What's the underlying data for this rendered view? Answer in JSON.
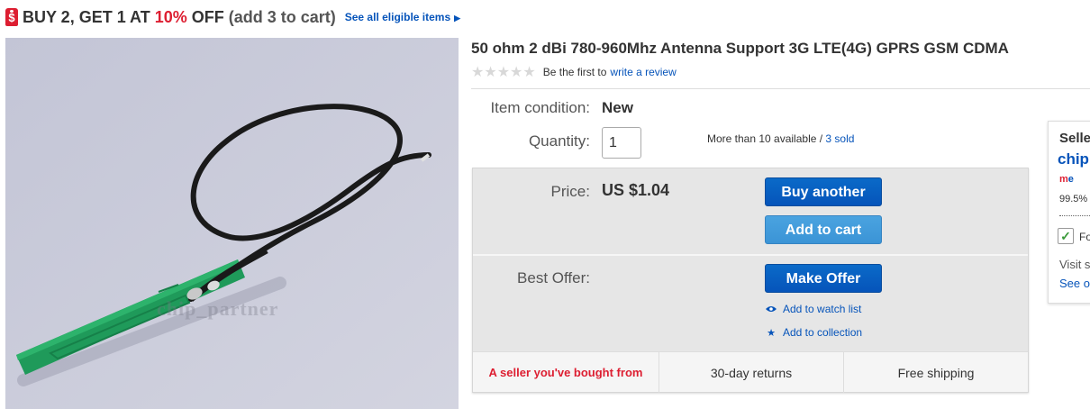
{
  "promo": {
    "tag_icon": "$",
    "text_before": "BUY 2, GET 1 AT ",
    "discount": "10%",
    "text_after": " OFF",
    "paren": " (add 3 to cart)",
    "link": "See all eligible items",
    "link_arrow": "▶"
  },
  "product": {
    "image_watermark": "chip_partner",
    "title": "50 ohm 2 dBi 780-960Mhz Antenna Support 3G LTE(4G) GPRS GSM CDMA",
    "rating_stars": "★★★★★",
    "rating_prefix": "Be the first to",
    "rating_link": "write a review"
  },
  "details": {
    "condition_label": "Item condition:",
    "condition_value": "New",
    "quantity_label": "Quantity:",
    "quantity_value": "1",
    "availability": "More than 10 available / ",
    "sold_link": "3 sold"
  },
  "buybox": {
    "price_label": "Price:",
    "price_value": "US $1.04",
    "buy_another": "Buy another",
    "add_to_cart": "Add to cart",
    "best_offer_label": "Best Offer:",
    "make_offer": "Make Offer",
    "watch_list": "Add to watch list",
    "collection": "Add to collection",
    "badges": [
      "A seller you've bought from",
      "30-day returns",
      "Free shipping"
    ]
  },
  "seller": {
    "title": "Selle",
    "name": "chip",
    "me_m": "m",
    "me_e": "e",
    "percent": "99.5%",
    "check": "✓",
    "follow": "Fo",
    "visit": "Visit s",
    "see": "See o"
  },
  "colors": {
    "accent_red": "#dd1e31",
    "link_blue": "#0654ba",
    "button_blue": "#0654ba",
    "button_light": "#3b94d6"
  }
}
